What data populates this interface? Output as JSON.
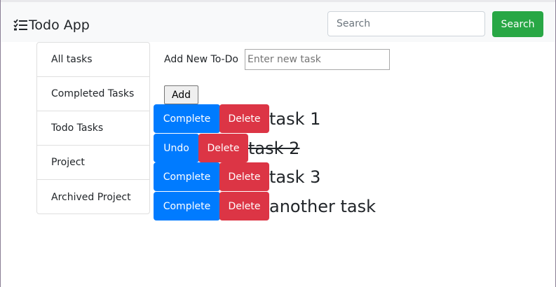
{
  "navbar": {
    "brand": "Todo App",
    "brand_icon": "tasks-checklist-icon",
    "search_placeholder": "Search",
    "search_button": "Search",
    "search_button_color": "#28a745"
  },
  "sidebar": {
    "items": [
      {
        "label": "All tasks"
      },
      {
        "label": "Completed Tasks"
      },
      {
        "label": "Todo Tasks"
      },
      {
        "label": "Project"
      },
      {
        "label": "Archived Project"
      }
    ]
  },
  "add_form": {
    "label": "Add New To-Do",
    "placeholder": "Enter new task",
    "button": "Add"
  },
  "tasks": [
    {
      "action": "Complete",
      "delete": "Delete",
      "text": "task 1",
      "completed": false
    },
    {
      "action": "Undo",
      "delete": "Delete",
      "text": "task 2",
      "completed": true
    },
    {
      "action": "Complete",
      "delete": "Delete",
      "text": "task 3",
      "completed": false
    },
    {
      "action": "Complete",
      "delete": "Delete",
      "text": "another task",
      "completed": false
    }
  ],
  "colors": {
    "primary": "#007bff",
    "danger": "#dc3545",
    "navbar_bg": "#f8f9fa"
  }
}
